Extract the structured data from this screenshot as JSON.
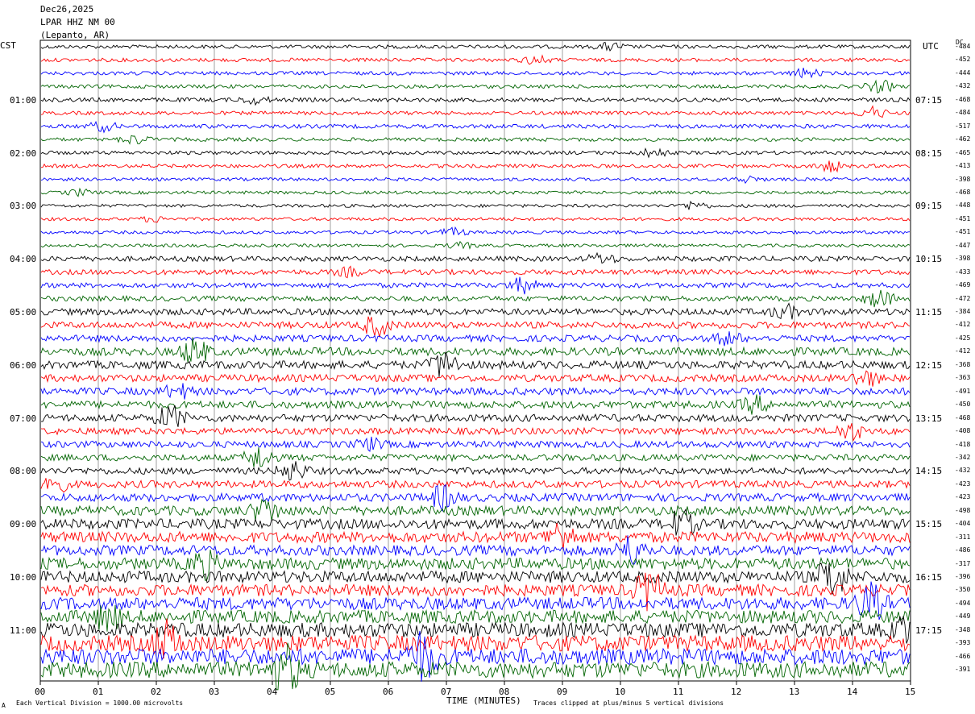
{
  "header": {
    "date": "Dec26,2025",
    "station": "LPAR HHZ NM 00",
    "location": "(Lepanto, AR)"
  },
  "left_timezone": "CST",
  "right_timezone": "UTC",
  "dc_label": "DC",
  "xlabel": "TIME (MINUTES)",
  "footer_left": "Each Vertical Division = 1000.00 microvolts",
  "footer_right": "Traces clipped at plus/minus 5 vertical divisions",
  "footer_mark": "A",
  "colors": {
    "black": "#000000",
    "red": "#ff0000",
    "blue": "#0000ff",
    "green": "#006400"
  },
  "chart_data": {
    "type": "line",
    "title": "LPAR HHZ NM 00",
    "x_ticks": [
      "00",
      "01",
      "02",
      "03",
      "04",
      "05",
      "06",
      "07",
      "08",
      "09",
      "10",
      "11",
      "12",
      "13",
      "14",
      "15"
    ],
    "xlim": [
      0,
      15
    ],
    "trace_count": 48,
    "trace_colors": [
      "black",
      "red",
      "blue",
      "green"
    ],
    "left_hour_labels": [
      "01:00",
      "02:00",
      "03:00",
      "04:00",
      "05:00",
      "06:00",
      "07:00",
      "08:00",
      "09:00",
      "10:00",
      "11:00"
    ],
    "right_hour_labels": [
      "07:15",
      "08:15",
      "09:15",
      "10:15",
      "11:15",
      "12:15",
      "13:15",
      "14:15",
      "15:15",
      "16:15",
      "17:15"
    ],
    "dc_offsets": [
      "-484",
      "-452",
      "-444",
      "-432",
      "-468",
      "-484",
      "-517",
      "-462",
      "-465",
      "-413",
      "-398",
      "-468",
      "-448",
      "-451",
      "-451",
      "-447",
      "-398",
      "-433",
      "-469",
      "-472",
      "-384",
      "-412",
      "-425",
      "-412",
      "-368",
      "-363",
      "-491",
      "-450",
      "-468",
      "-408",
      "-418",
      "-342",
      "-432",
      "-423",
      "-423",
      "-498",
      "-404",
      "-311",
      "-486",
      "-317",
      "-396",
      "-350",
      "-494",
      "-449",
      "-348",
      "-393",
      "-466",
      "-391"
    ],
    "amplitudes": [
      0.25,
      0.25,
      0.25,
      0.25,
      0.28,
      0.25,
      0.28,
      0.25,
      0.25,
      0.25,
      0.22,
      0.22,
      0.22,
      0.22,
      0.22,
      0.22,
      0.35,
      0.35,
      0.35,
      0.35,
      0.45,
      0.45,
      0.45,
      0.55,
      0.55,
      0.5,
      0.5,
      0.5,
      0.5,
      0.45,
      0.45,
      0.45,
      0.45,
      0.5,
      0.55,
      0.65,
      0.7,
      0.75,
      0.7,
      0.8,
      0.8,
      0.8,
      0.85,
      0.9,
      1.0,
      1.1,
      1.1,
      1.1
    ]
  }
}
